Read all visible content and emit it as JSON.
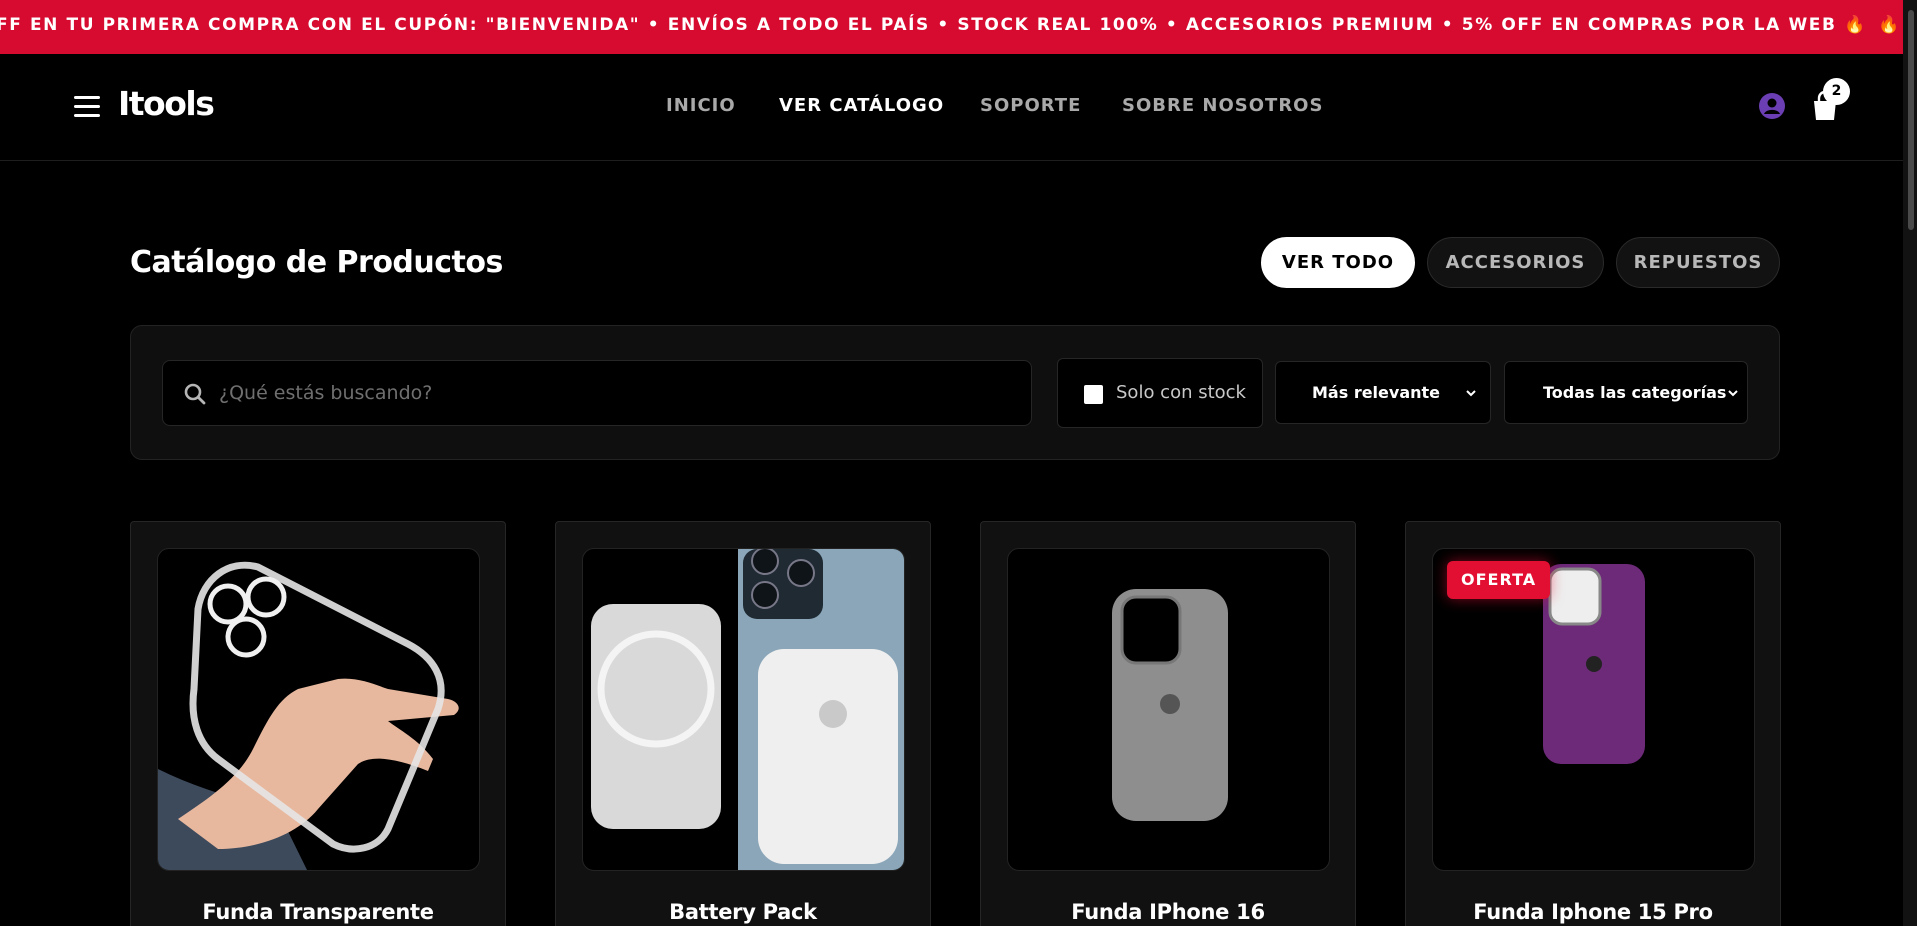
{
  "promo_bar": {
    "text": "FF EN TU PRIMERA COMPRA CON EL CUPÓN: \"BIENVENIDA\" • ENVÍOS A TODO EL PAÍS • STOCK REAL 100% • ACCESORIOS PREMIUM • 5% OFF EN COMPRAS POR LA WEB 🔥",
    "text_repeat": "🔥 1",
    "color": "#d70a30"
  },
  "header": {
    "logo": "Itools",
    "nav": [
      {
        "label": "INICIO",
        "active": false
      },
      {
        "label": "VER CATÁLOGO",
        "active": true
      },
      {
        "label": "SOPORTE",
        "active": false
      },
      {
        "label": "SOBRE NOSOTROS",
        "active": false
      }
    ],
    "cart_count": "2",
    "icons": {
      "menu": "hamburger-menu-icon",
      "user": "user-icon",
      "cart": "shopping-bag-icon"
    },
    "user_icon_color": "#6b3fb3"
  },
  "catalog": {
    "title": "Catálogo de Productos",
    "tabs": [
      {
        "label": "VER TODO",
        "active": true
      },
      {
        "label": "ACCESORIOS",
        "active": false
      },
      {
        "label": "REPUESTOS",
        "active": false
      }
    ]
  },
  "filters": {
    "search_placeholder": "¿Qué estás buscando?",
    "search_value": "",
    "stock_label": "Solo con stock",
    "stock_checked": false,
    "sort_selected": "Más relevante",
    "category_selected": "Todas las categorías"
  },
  "products": [
    {
      "name": "Funda Transparente",
      "badge": "",
      "image": "clear-case-in-hand"
    },
    {
      "name": "Battery Pack",
      "badge": "",
      "image": "magsafe-battery-pack"
    },
    {
      "name": "Funda IPhone 16",
      "badge": "",
      "image": "gray-silicone-case"
    },
    {
      "name": "Funda Iphone 15 Pro",
      "badge": "OFERTA",
      "image": "purple-silicone-case"
    }
  ],
  "colors": {
    "accent": "#e20f33",
    "background": "#000000",
    "card": "#111111"
  }
}
